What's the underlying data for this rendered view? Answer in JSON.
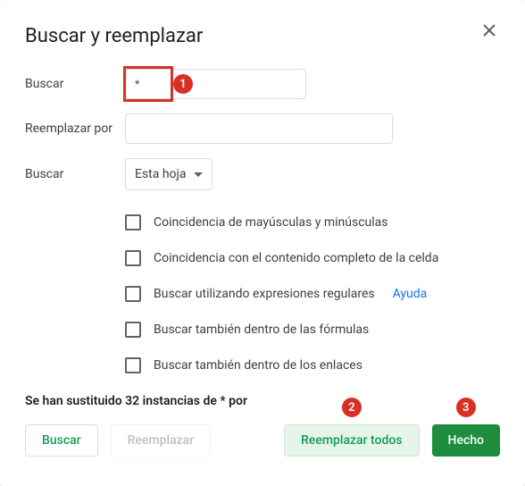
{
  "dialog": {
    "title": "Buscar y reemplazar",
    "close_aria": "Cerrar"
  },
  "fields": {
    "search_label": "Buscar",
    "search_value": "*",
    "replace_label": "Reemplazar por",
    "replace_value": "",
    "scope_label": "Buscar",
    "scope_selected": "Esta hoja"
  },
  "options": {
    "match_case": "Coincidencia de mayúsculas y minúsculas",
    "match_entire": "Coincidencia con el contenido completo de la celda",
    "use_regex": "Buscar utilizando expresiones regulares",
    "regex_help": "Ayuda",
    "in_formulas": "Buscar también dentro de las fórmulas",
    "in_links": "Buscar también dentro de los enlaces"
  },
  "status": "Se han sustituido 32 instancias de * por",
  "buttons": {
    "find": "Buscar",
    "replace": "Reemplazar",
    "replace_all": "Reemplazar todos",
    "done": "Hecho"
  },
  "annotations": {
    "b1": "1",
    "b2": "2",
    "b3": "3"
  }
}
